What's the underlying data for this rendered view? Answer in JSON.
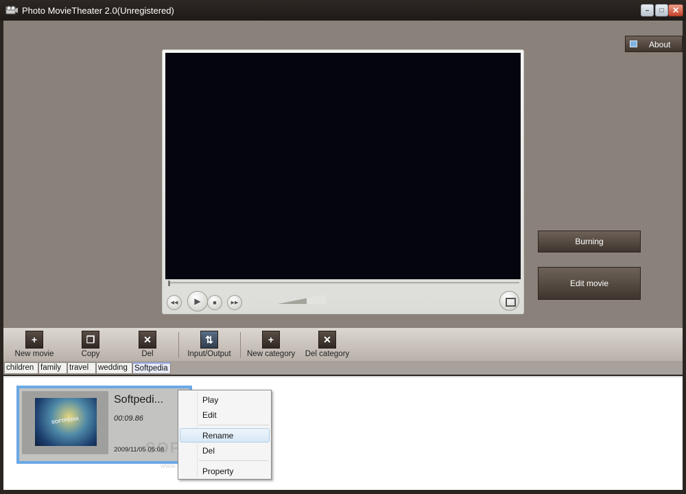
{
  "window": {
    "title": "Photo MovieTheater 2.0(Unregistered)",
    "icon": "film-reel-icon",
    "controls": {
      "minimize": "–",
      "maximize": "□",
      "close": "✕"
    }
  },
  "header": {
    "about_label": "About"
  },
  "side_actions": {
    "burning_label": "Burning",
    "edit_movie_label": "Edit movie"
  },
  "player": {
    "controls": {
      "rewind": "◀◀",
      "play": "▶",
      "stop": "■",
      "forward": "▶▶"
    },
    "seek_position": 0,
    "volume_level": 0.6
  },
  "toolbar": {
    "items": [
      {
        "label": "New movie",
        "icon": "plus-icon",
        "glyph": "+"
      },
      {
        "label": "Copy",
        "icon": "copy-icon",
        "glyph": "❐"
      },
      {
        "label": "Del",
        "icon": "delete-icon",
        "glyph": "✕"
      },
      {
        "label": "Input/Output",
        "icon": "input-output-icon",
        "glyph": "⇅"
      },
      {
        "label": "New category",
        "icon": "new-category-icon",
        "glyph": "+"
      },
      {
        "label": "Del category",
        "icon": "del-category-icon",
        "glyph": "✕"
      }
    ]
  },
  "tabs": [
    "children",
    "family",
    "travel",
    "wedding",
    "Softpedia"
  ],
  "active_tab": "Softpedia",
  "movies": [
    {
      "title": "Softpedi...",
      "duration": "00:09.86",
      "date": "2009/11/05 05:08"
    }
  ],
  "context_menu": {
    "items": [
      "Play",
      "Edit",
      "Rename",
      "Del",
      "Property"
    ],
    "highlighted": "Rename"
  },
  "watermark": {
    "text": "SOFTPEDIA",
    "sub": "www.softpedia.com"
  },
  "colors": {
    "selection_border": "#6aa8e6",
    "button_dark": "#3f352e",
    "background": "#8a817b"
  }
}
